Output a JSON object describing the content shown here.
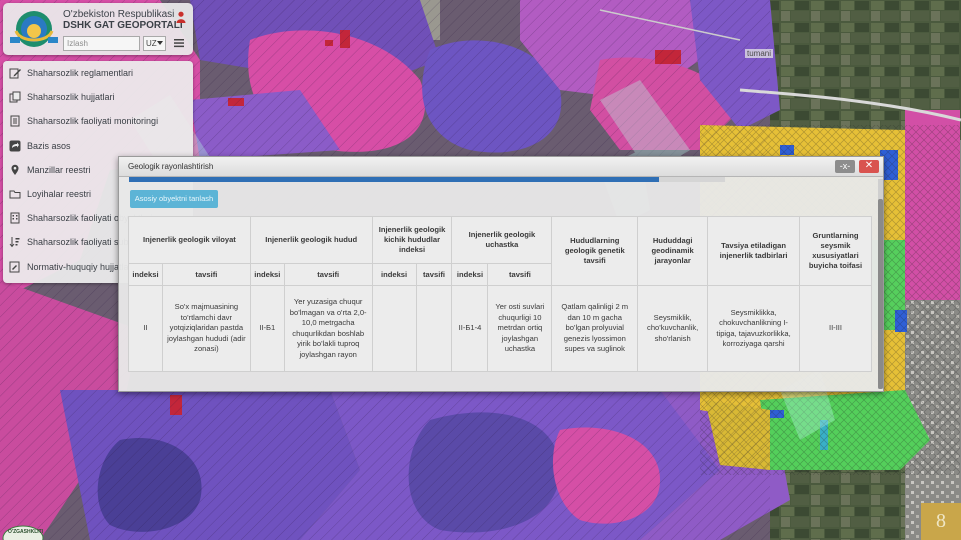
{
  "header": {
    "title_line1": "O'zbekiston Respublikasi",
    "title_line2": "DSHK GAT GEOPORTALI",
    "search_placeholder": "Izlash",
    "language": "UZ"
  },
  "sidebar": {
    "items": [
      {
        "label": "Shaharsozlik reglamentlari",
        "icon": "edit-icon"
      },
      {
        "label": "Shaharsozlik hujjatlari",
        "icon": "documents-icon"
      },
      {
        "label": "Shaharsozlik faoliyati monitoringi",
        "icon": "report-icon"
      },
      {
        "label": "Bazis asos",
        "icon": "share-icon"
      },
      {
        "label": "Manzillar reestri",
        "icon": "map-pin-icon"
      },
      {
        "label": "Loyihalar reestri",
        "icon": "folder-icon"
      },
      {
        "label": "Shaharsozlik faoliyati obyektlari",
        "icon": "building-icon"
      },
      {
        "label": "Shaharsozlik faoliyati subyektlari",
        "icon": "sort-icon"
      },
      {
        "label": "Normativ-huquqiy hujjatlar",
        "icon": "law-document-icon"
      }
    ]
  },
  "map": {
    "place_label": "tumani"
  },
  "modal": {
    "title": "Geologik rayonlashtirish",
    "minimize_label": "-x-",
    "close_label": "✕",
    "progress": 0.89,
    "button_label": "Asosiy obyektni tanlash",
    "table": {
      "group_headers": [
        "Injenerlik geologik viloyat",
        "Injenerlik geologik hudud",
        "Injenerlik geologik kichik hududlar indeksi",
        "Injenerlik geologik uchastka",
        "Hududlarning geologik genetik tavsifi",
        "Hududdagi geodinamik jarayonlar",
        "Tavsiya etiladigan injenerlik tadbirlari",
        "Gruntlarning seysmik xususiyatlari buyicha toifasi"
      ],
      "sub_headers": [
        "indeksi",
        "tavsifi",
        "indeksi",
        "tavsifi",
        "indeksi",
        "tavsifi",
        "indeksi",
        "tavsifi"
      ],
      "row": [
        "II",
        "So'x majmuasining to'rtlamchi davr yotqiziqlaridan pastda joylashgan hududi (adir zonasi)",
        "II-Б1",
        "Yer yuzasiga chuqur bo'lmagan va o'rta 2,0-10,0 metrgacha chuqurlikdan boshlab yirik bo'lakli tuproq joylashgan rayon",
        "",
        "",
        "II-Б1-4",
        "Yer osti suvlari chuqurligi 10 metrdan ortiq joylashgan uchastka",
        "Qatlam qalinligi 2 m dan 10 m gacha bo'lgan prolyuvial genezis lyossimon supes va suglinok",
        "Seysmiklik, cho'kuvchanlik, sho'rlanish",
        "Seysmiklikka, chokuvchanlikning I-tipiga, tajavuzkorlikka, korroziyaga qarshi",
        "II-III"
      ]
    }
  },
  "footer": {
    "page_number": "8",
    "logo_text": "O'ZGASHKLITI"
  },
  "colors": {
    "magenta": "#d94fa8",
    "purple": "#7b55c6",
    "violet": "#a565c9",
    "yellow": "#e8c33a",
    "green": "#5ad15f",
    "blue": "#2d5fd3",
    "close_red": "#d9534f",
    "button_blue": "#5cb4d6",
    "progress_blue": "#2f6fb5"
  }
}
